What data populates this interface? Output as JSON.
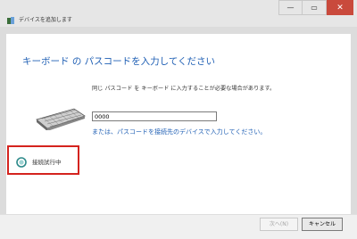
{
  "window": {
    "title": "デバイスを追加します",
    "controls": {
      "minimize": "—",
      "maximize": "▭",
      "close": "✕"
    }
  },
  "main": {
    "heading": "キーボード の パスコードを入力してください",
    "info": "同じ パスコード を キーボード に入力することが必要な場合があります。",
    "passcode_value": "0000",
    "alt_link": "または、パスコードを接続先のデバイスで入力してください。"
  },
  "status": {
    "text": "接続試行中"
  },
  "footer": {
    "next_label": "次へ(N)",
    "cancel_label": "キャンセル"
  },
  "colors": {
    "heading": "#1f5fb4",
    "highlight_border": "#d4231e",
    "close_button": "#c94a3c"
  },
  "icons": {
    "app": "bluetooth-device-icon",
    "keyboard": "keyboard-icon",
    "status": "connecting-spinner-icon"
  }
}
